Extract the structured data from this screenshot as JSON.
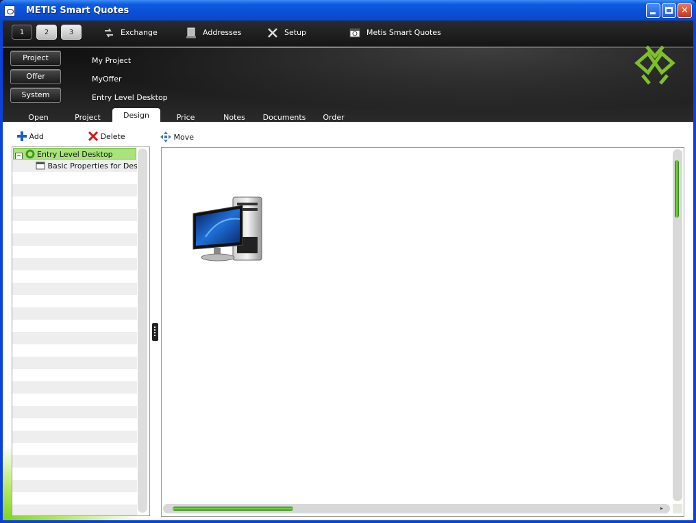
{
  "window": {
    "title": "METIS Smart Quotes"
  },
  "topbar": {
    "numbers": [
      "1",
      "2",
      "3"
    ],
    "selected_number": "2",
    "exchange": "Exchange",
    "addresses": "Addresses",
    "setup": "Setup",
    "app": "Metis Smart Quotes"
  },
  "context": {
    "project_button": "Project",
    "offer_button": "Offer",
    "system_button": "System",
    "project_value": "My Project",
    "offer_value": "MyOffer",
    "system_value": "Entry Level Desktop"
  },
  "tabs": [
    "Open",
    "Project",
    "Design",
    "Price",
    "Notes",
    "Documents",
    "Order"
  ],
  "active_tab": "Design",
  "design_toolbar": {
    "add": "Add",
    "delete": "Delete",
    "move": "Move"
  },
  "tree": {
    "root": "Entry Level Desktop",
    "child": "Basic Properties for Desk"
  },
  "colors": {
    "accent_green": "#7fdc4a",
    "selection_green": "#a9e47a",
    "header_dark": "#111111",
    "titlebar_blue": "#0a4fd6"
  }
}
